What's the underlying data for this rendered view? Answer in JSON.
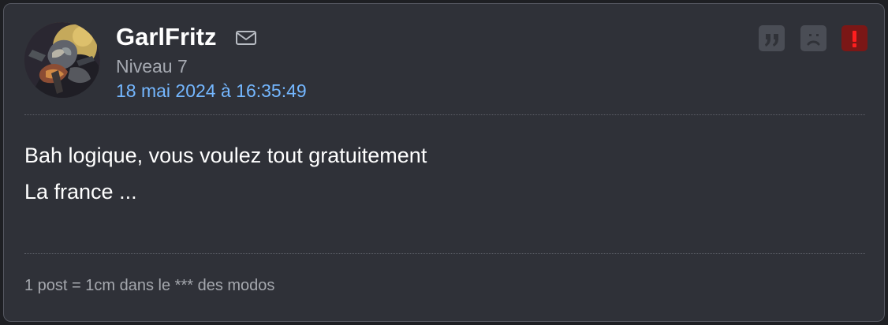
{
  "post": {
    "author": {
      "username": "GarlFritz",
      "level": "Niveau 7",
      "avatar_icon": "armored-character-avatar",
      "message_icon": "mail-icon"
    },
    "timestamp": "18 mai 2024 à 16:35:49",
    "content": {
      "lines": [
        "Bah logique, vous voulez tout gratuitement",
        "La france ..."
      ]
    },
    "signature": "1 post = 1cm dans le *** des modos",
    "actions": {
      "quote_icon": "quote-icon",
      "sad_icon": "sad-face-icon",
      "report_icon": "exclamation-icon"
    }
  },
  "colors": {
    "background": "#2f3138",
    "border": "#555861",
    "username": "#ffffff",
    "level": "#a5a9b1",
    "date_link": "#74b7ff",
    "message_text": "#ffffff",
    "signature": "#a5a8ae",
    "action_button": "#4a4d55",
    "report_button": "#7b1716"
  }
}
